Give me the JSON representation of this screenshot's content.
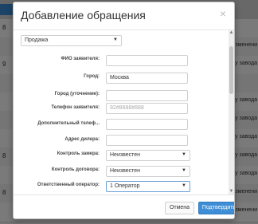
{
  "background": {
    "badge": "",
    "rows": [
      {
        "idx": "8",
        "right": ""
      },
      {
        "idx": "",
        "right": "ь изменени"
      },
      {
        "idx": "9",
        "right": "у завода"
      },
      {
        "idx": "",
        "right": ""
      },
      {
        "idx": "",
        "right": "у завода"
      },
      {
        "idx": "",
        "right": "у завода"
      },
      {
        "idx": "",
        "right": "у завода"
      },
      {
        "idx": "8",
        "right": "у завода"
      },
      {
        "idx": "",
        "right": "у завода"
      },
      {
        "idx": "8",
        "right": "ь изменени"
      },
      {
        "idx": "",
        "right": "ь изменени"
      }
    ]
  },
  "modal": {
    "title": "Добавление обращения",
    "close_label": "×",
    "type_select": "Продажа",
    "fields": {
      "fio_label": "ФИО заявителя:",
      "fio_value": "",
      "city_label": "Город:",
      "city_value": "Москва",
      "city_ref_label": "Город (уточнение):",
      "city_ref_value": "",
      "phone_label": "Телефон заявителя:",
      "phone_value": "92#8888#888",
      "extra_phone_label": "Дополнительный телеф...",
      "extra_phone_value": "",
      "dealer_address_label": "Адрес дилера:",
      "dealer_address_value": "",
      "measure_control_label": "Контроль замера:",
      "measure_control_value": "Неизвестен",
      "contract_control_label": "Контроль договора:",
      "contract_control_value": "Неизвестен",
      "operator_label": "Ответственный оператор:",
      "operator_value": "1 Оператор"
    },
    "buttons": {
      "cancel": "Отмена",
      "confirm": "Подтвердить"
    }
  },
  "colors": {
    "accent": "#3d8ed6",
    "overlay": "rgba(0,0,0,0.52)"
  },
  "icons": {
    "close": "close-icon",
    "dropdown": "chevron-down-icon"
  }
}
